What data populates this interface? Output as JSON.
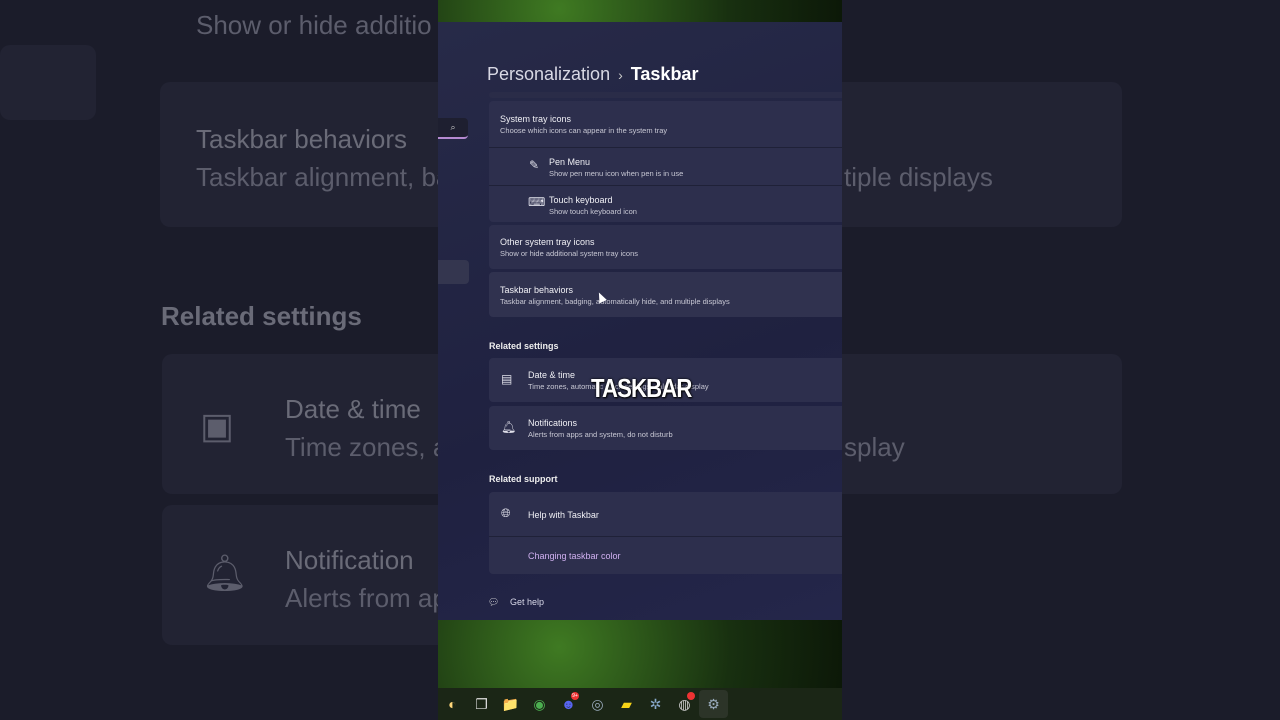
{
  "background": {
    "left_texts": [
      "Show or hide additio",
      "Taskbar behaviors",
      "Taskbar alignment, ba",
      "Related settings",
      "Date & time",
      "Time zones, a",
      "Notification",
      "Alerts from ap"
    ],
    "right_texts": [
      "tiple displays",
      "splay"
    ]
  },
  "breadcrumb": {
    "parent": "Personalization",
    "separator": "›",
    "current": "Taskbar"
  },
  "search_icon": "⌕",
  "tray": {
    "system_tray": {
      "title": "System tray icons",
      "sub": "Choose which icons can appear in the system tray"
    },
    "pen_menu": {
      "title": "Pen Menu",
      "sub": "Show pen menu icon when pen is in use"
    },
    "touch_keyboard": {
      "title": "Touch keyboard",
      "sub": "Show touch keyboard icon"
    },
    "other": {
      "title": "Other system tray icons",
      "sub": "Show or hide additional system tray icons"
    },
    "behaviors": {
      "title": "Taskbar behaviors",
      "sub": "Taskbar alignment, badging, automatically hide, and multiple displays"
    }
  },
  "related_settings": {
    "heading": "Related settings",
    "date_time": {
      "title": "Date & time",
      "sub": "Time zones, automatic clock settings, calendar display"
    },
    "notifications": {
      "title": "Notifications",
      "sub": "Alerts from apps and system, do not disturb"
    }
  },
  "related_support": {
    "heading": "Related support",
    "help": "Help with Taskbar",
    "link": "Changing taskbar color"
  },
  "get_help": "Get help",
  "overlay_caption": "TASKBAR",
  "taskbar_apps": [
    {
      "name": "widgets",
      "glyph": "◐"
    },
    {
      "name": "task-view",
      "glyph": "❐"
    },
    {
      "name": "file-explorer",
      "glyph": "📁"
    },
    {
      "name": "chrome",
      "glyph": "◉"
    },
    {
      "name": "discord",
      "glyph": "☻",
      "badge": "9+"
    },
    {
      "name": "steam",
      "glyph": "◎"
    },
    {
      "name": "sticky-notes",
      "glyph": "▰"
    },
    {
      "name": "davinci-resolve",
      "glyph": "✲"
    },
    {
      "name": "obs",
      "glyph": "◍",
      "badge": ""
    },
    {
      "name": "settings",
      "glyph": "⚙"
    }
  ]
}
